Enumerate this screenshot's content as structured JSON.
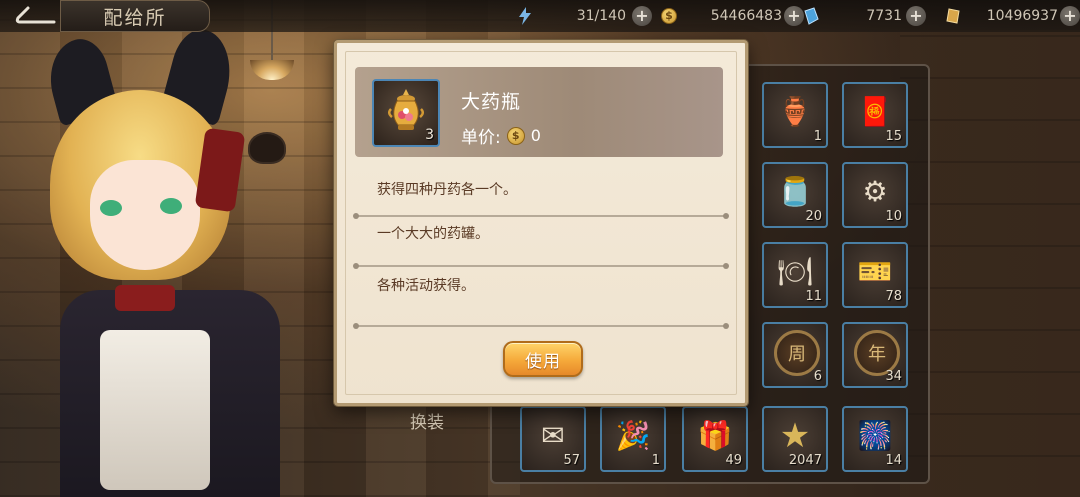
{
  "screen": {
    "title": "配给所"
  },
  "resources": {
    "stamina": {
      "value": "31/140",
      "icon": "lightning-icon"
    },
    "gold": {
      "value": "54466483",
      "icon": "gold-coin-icon"
    },
    "blue_gem": {
      "value": "7731",
      "icon": "blue-crystal-icon"
    },
    "fragment": {
      "value": "10496937",
      "icon": "amber-crystal-icon"
    }
  },
  "dialog": {
    "item_name": "大药瓶",
    "item_quantity": "3",
    "price_label": "单价:",
    "price_value": "0",
    "descriptions": [
      "获得四种丹药各一个。",
      "一个大大的药罐。",
      "各种活动获得。"
    ],
    "use_button": "使用"
  },
  "inventory": [
    {
      "icon": "potion-bottle-icon",
      "count": "1"
    },
    {
      "icon": "red-envelope-icon",
      "count": "15"
    },
    {
      "icon": "blue-jar-icon",
      "count": "20"
    },
    {
      "icon": "seal-medal-icon",
      "count": "10"
    },
    {
      "icon": "food-plate-icon",
      "count": "11"
    },
    {
      "icon": "red-ticket-box-icon",
      "count": "78"
    },
    {
      "icon": "zhou-coin-icon",
      "count": "6",
      "glyph": "周"
    },
    {
      "icon": "nian-coin-icon",
      "count": "34",
      "glyph": "年"
    },
    {
      "icon": "letter-icon",
      "count": "57"
    },
    {
      "icon": "party-popper-icon",
      "count": "1"
    },
    {
      "icon": "gift-pack-icon",
      "count": "49"
    },
    {
      "icon": "star-icon",
      "count": "2047"
    },
    {
      "icon": "firework-icon",
      "count": "14"
    }
  ],
  "swap_label": "换装",
  "colors": {
    "accent": "#f5a93a",
    "panel": "#f4ead9",
    "slot_border": "#4a7fa4"
  }
}
